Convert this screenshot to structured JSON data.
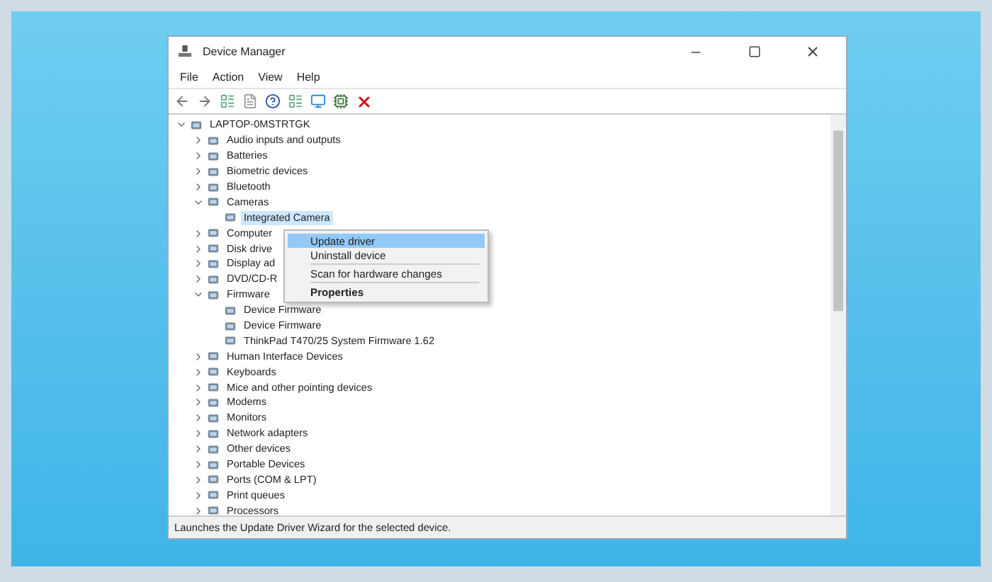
{
  "window": {
    "title": "Device Manager"
  },
  "menu_bar": [
    "File",
    "Action",
    "View",
    "Help"
  ],
  "tree": [
    {
      "label": "LAPTOP-0MSTRTGK",
      "expanded": true,
      "selected": false,
      "children": [
        {
          "label": "Audio inputs and outputs",
          "expanded": false,
          "selected": false
        },
        {
          "label": "Batteries",
          "expanded": false,
          "selected": false
        },
        {
          "label": "Biometric devices",
          "expanded": false,
          "selected": false
        },
        {
          "label": "Bluetooth",
          "expanded": false,
          "selected": false
        },
        {
          "label": "Cameras",
          "expanded": true,
          "selected": false,
          "children": [
            {
              "label": "Integrated Camera",
              "selected": true
            }
          ]
        },
        {
          "label": "Computer",
          "expanded": false,
          "selected": false
        },
        {
          "label": "Disk drive",
          "expanded": false,
          "selected": false
        },
        {
          "label": "Display ad",
          "expanded": false,
          "selected": false
        },
        {
          "label": "DVD/CD-R",
          "expanded": false,
          "selected": false
        },
        {
          "label": "Firmware",
          "expanded": true,
          "selected": false,
          "children": [
            {
              "label": "Device Firmware",
              "selected": false
            },
            {
              "label": "Device Firmware",
              "selected": false
            },
            {
              "label": "ThinkPad T470/25 System Firmware 1.62",
              "selected": false
            }
          ]
        },
        {
          "label": "Human Interface Devices",
          "expanded": false,
          "selected": false
        },
        {
          "label": "Keyboards",
          "expanded": false,
          "selected": false
        },
        {
          "label": "Mice and other pointing devices",
          "expanded": false,
          "selected": false
        },
        {
          "label": "Modems",
          "expanded": false,
          "selected": false
        },
        {
          "label": "Monitors",
          "expanded": false,
          "selected": false
        },
        {
          "label": "Network adapters",
          "expanded": false,
          "selected": false
        },
        {
          "label": "Other devices",
          "expanded": false,
          "selected": false
        },
        {
          "label": "Portable Devices",
          "expanded": false,
          "selected": false
        },
        {
          "label": "Ports (COM & LPT)",
          "expanded": false,
          "selected": false
        },
        {
          "label": "Print queues",
          "expanded": false,
          "selected": false
        },
        {
          "label": "Processors",
          "expanded": false,
          "selected": false
        }
      ]
    }
  ],
  "context_menu": [
    {
      "kind": "item",
      "label": "Update driver",
      "selected": true,
      "default": false
    },
    {
      "kind": "item",
      "label": "Uninstall device",
      "selected": false,
      "default": false
    },
    {
      "kind": "separator"
    },
    {
      "kind": "item",
      "label": "Scan for hardware changes",
      "selected": false,
      "default": false
    },
    {
      "kind": "separator"
    },
    {
      "kind": "item",
      "label": "Properties",
      "selected": false,
      "default": true
    }
  ],
  "status_bar": "Launches the Update Driver Wizard for the selected device."
}
